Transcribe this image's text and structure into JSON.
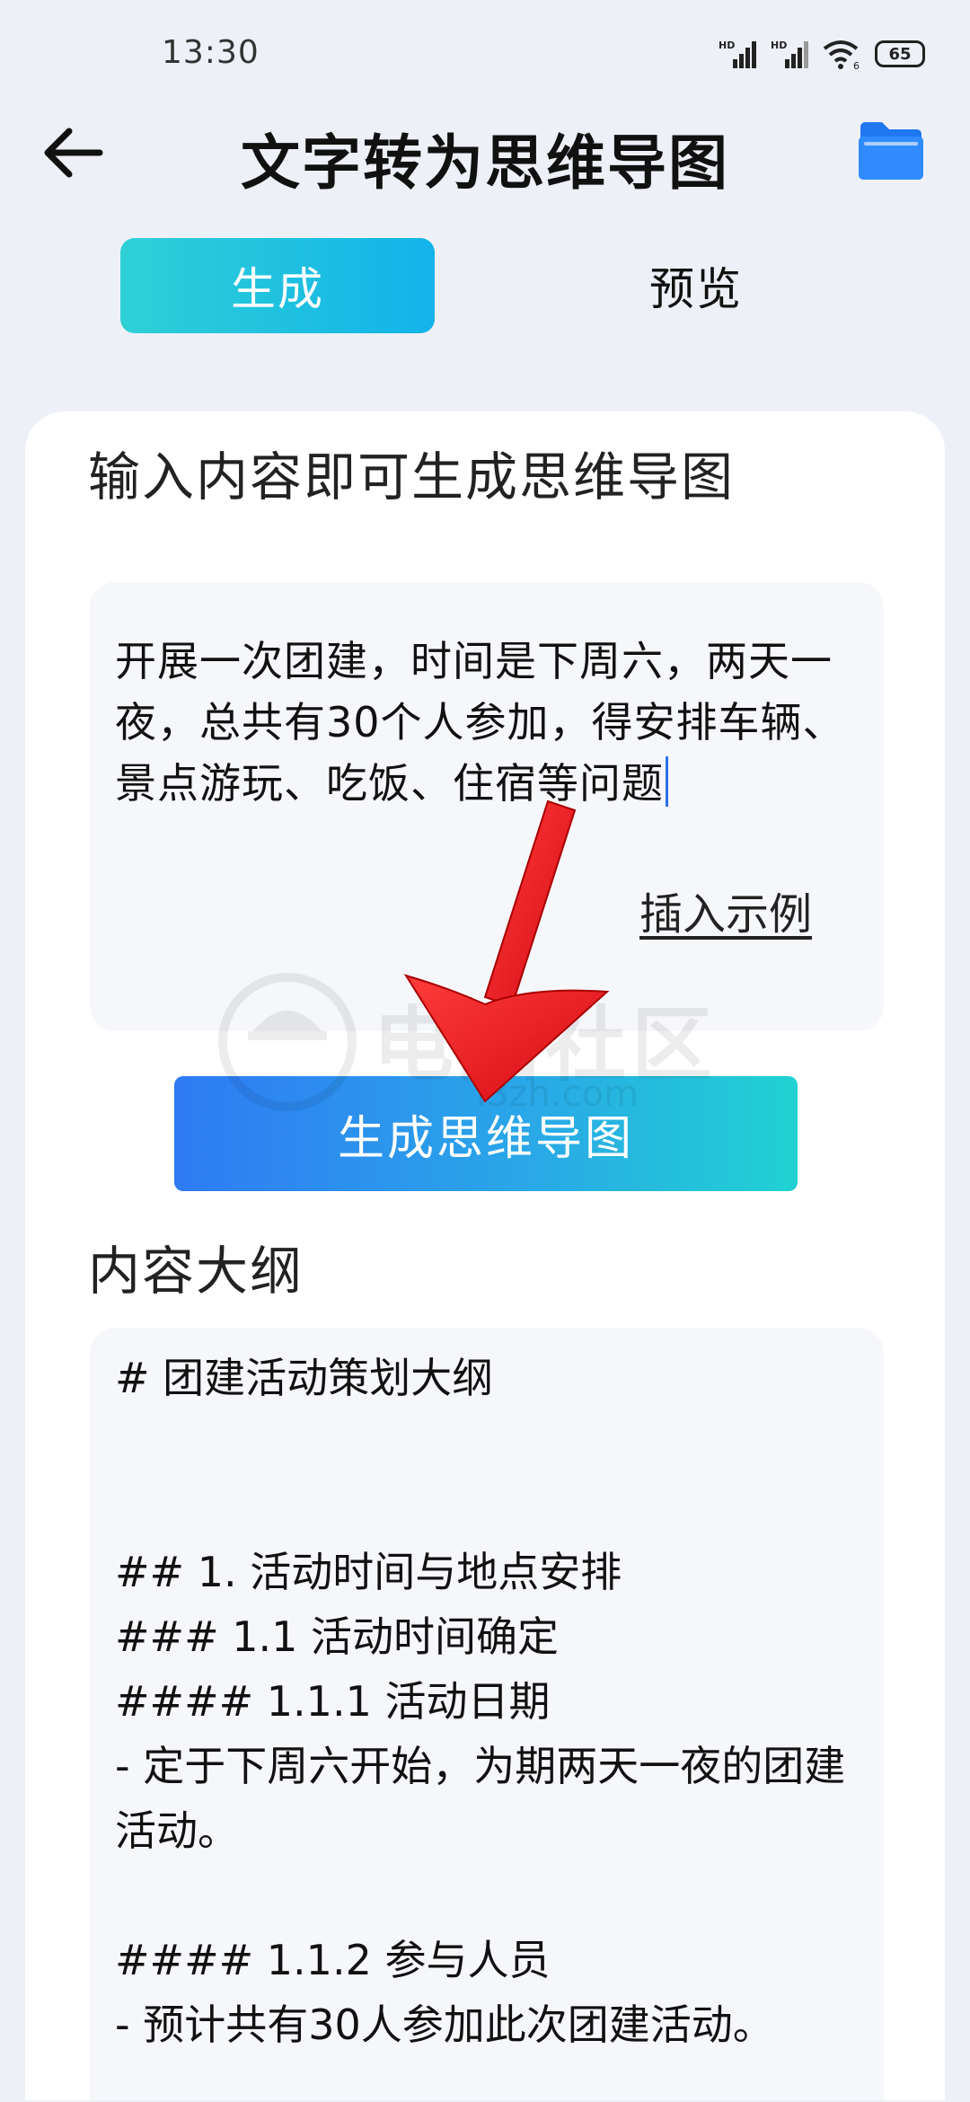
{
  "status_bar": {
    "time": "13:30",
    "signal1_label": "HD",
    "signal2_label": "HD",
    "battery": "65"
  },
  "header": {
    "title": "文字转为思维导图",
    "back_icon": "arrow-left-icon",
    "folder_icon": "folder-icon",
    "folder_color": "#1f78f0"
  },
  "tabs": {
    "generate_label": "生成",
    "preview_label": "预览"
  },
  "input_section": {
    "title": "输入内容即可生成思维导图",
    "value": "开展一次团建，时间是下周六，两天一夜，总共有30个人参加，得安排车辆、景点游玩、吃饭、住宿等问题",
    "insert_example_label": "插入示例"
  },
  "generate_button": {
    "label": "生成思维导图"
  },
  "outline_section": {
    "title": "内容大纲",
    "lines": [
      "# 团建活动策划大纲",
      "",
      "",
      "## 1. 活动时间与地点安排",
      "### 1.1 活动时间确定",
      "#### 1.1.1 活动日期",
      "- 定于下周六开始，为期两天一夜的团建活动。",
      "",
      "#### 1.1.2 参与人员",
      "- 预计共有30人参加此次团建活动。"
    ]
  },
  "watermark": {
    "text": "电脑社区",
    "url": "i3zh.com"
  },
  "colors": {
    "accent_teal": "#20c8dc",
    "accent_blue": "#2f7af4",
    "arrow_red": "#e8161c"
  }
}
